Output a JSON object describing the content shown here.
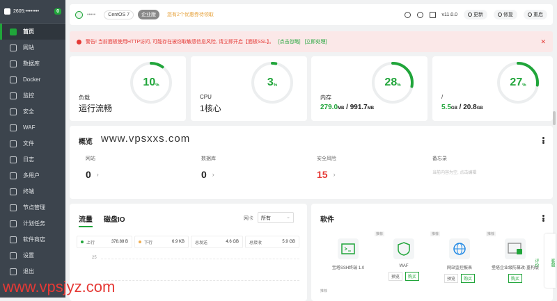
{
  "sidebar": {
    "host": "2605:••••••••",
    "badge": "0",
    "items": [
      {
        "label": "首页",
        "icon": "home-icon"
      },
      {
        "label": "网站",
        "icon": "globe-icon"
      },
      {
        "label": "数据库",
        "icon": "database-icon"
      },
      {
        "label": "Docker",
        "icon": "docker-icon"
      },
      {
        "label": "监控",
        "icon": "monitor-icon"
      },
      {
        "label": "安全",
        "icon": "shield-icon"
      },
      {
        "label": "WAF",
        "icon": "waf-icon"
      },
      {
        "label": "文件",
        "icon": "folder-icon"
      },
      {
        "label": "日志",
        "icon": "log-icon"
      },
      {
        "label": "多用户",
        "icon": "users-icon"
      },
      {
        "label": "终端",
        "icon": "terminal-icon"
      },
      {
        "label": "节点管理",
        "icon": "node-icon"
      },
      {
        "label": "计划任务",
        "icon": "clock-icon"
      },
      {
        "label": "软件商店",
        "icon": "store-icon"
      },
      {
        "label": "设置",
        "icon": "gear-icon"
      },
      {
        "label": "退出",
        "icon": "logout-icon"
      }
    ]
  },
  "topbar": {
    "username": "•••••",
    "os": "CentOS 7",
    "edition": "企业版",
    "promo": "您有2个优惠券待领取",
    "version": "v11.0.0",
    "update": "更新",
    "repair": "修复",
    "restart": "重启"
  },
  "alert": {
    "text": "警告! 当前面板使用HTTP访问, 可能存在被窃取敏感信息风险, 请立即开启【面板SSL】。",
    "link1": "[点击忽略]",
    "link2": "[立即处理]",
    "close": "✕"
  },
  "stats": [
    {
      "label": "负载",
      "value": "运行流畅",
      "percent": 10
    },
    {
      "label": "CPU",
      "value": "1核心",
      "percent": 3
    },
    {
      "label": "内存",
      "used": "279.0",
      "used_unit": "MB",
      "total": "991.7",
      "total_unit": "MB",
      "percent": 28
    },
    {
      "label": "/",
      "used": "5.5",
      "used_unit": "GB",
      "total": "20.8",
      "total_unit": "GB",
      "percent": 27
    }
  ],
  "overview": {
    "title": "概览",
    "url": "www.vpsxxs.com",
    "sites_label": "网站",
    "sites": "0",
    "db_label": "数据库",
    "db": "0",
    "risk_label": "安全风险",
    "risk": "15",
    "memo_label": "备忘录",
    "memo_placeholder": "当前内容为空, 点击编辑"
  },
  "traffic": {
    "tab1": "流量",
    "tab2": "磁盘IO",
    "nic_label": "网卡",
    "nic_value": "所有",
    "up_label": "上行",
    "up": "378.88 B",
    "down_label": "下行",
    "down": "6.9 KB",
    "sent_label": "总发送",
    "sent": "4.6 GB",
    "recv_label": "总接收",
    "recv": "5.9 GB",
    "axis_tick": "25"
  },
  "software": {
    "title": "软件",
    "items": [
      {
        "tag": "推荐",
        "name": "宝塔SSH终端 1.0"
      },
      {
        "tag": "推荐",
        "name": "WAF",
        "b1": "预览",
        "b2": "购买"
      },
      {
        "tag": "推荐",
        "name": "网站监控报表",
        "b1": "预览",
        "b2": "购买"
      },
      {
        "tag": "推荐",
        "name": "堡塔企业级防篡改-重构版",
        "b2": "购买"
      }
    ],
    "tag_extra": "推荐"
  },
  "side_tabs": {
    "service": "客服",
    "review": "评价"
  },
  "watermark": "www.vpsjyz.com",
  "colors": {
    "accent": "#20a53a",
    "danger": "#e53935",
    "sidebar": "#3c444d"
  }
}
